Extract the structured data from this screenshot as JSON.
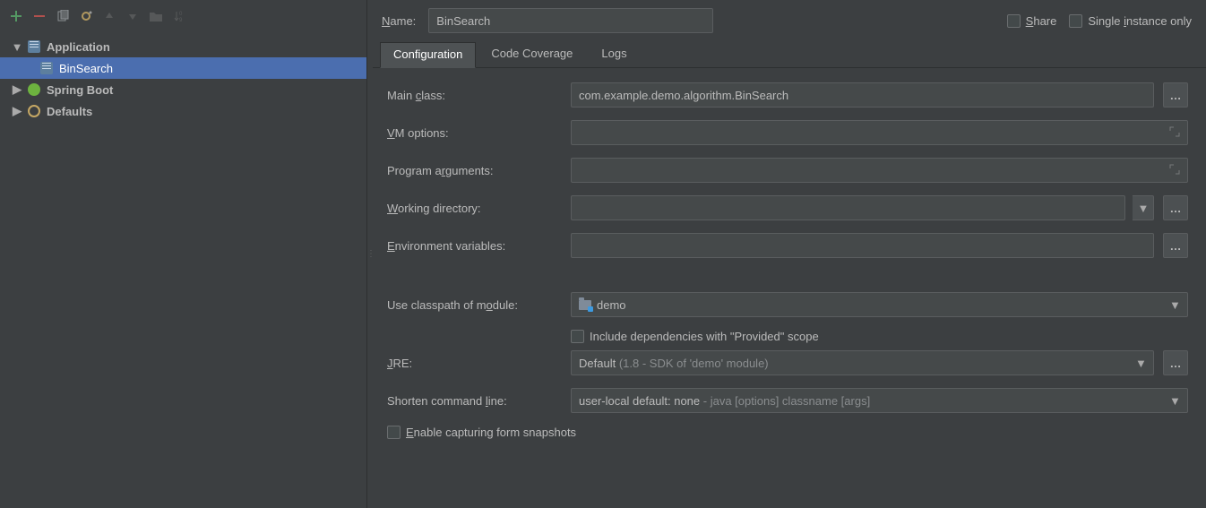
{
  "header": {
    "name_label": "Name:",
    "name_value": "BinSearch",
    "share_label": "Share",
    "single_instance_label": "Single instance only"
  },
  "sidebar": {
    "items": [
      {
        "label": "Application",
        "expanded": true,
        "children": [
          {
            "label": "BinSearch",
            "selected": true
          }
        ]
      },
      {
        "label": "Spring Boot",
        "expanded": false
      },
      {
        "label": "Defaults",
        "expanded": false
      }
    ]
  },
  "tabs": {
    "items": [
      "Configuration",
      "Code Coverage",
      "Logs"
    ],
    "active": 0
  },
  "form": {
    "main_class_label": "Main class:",
    "main_class_value": "com.example.demo.algorithm.BinSearch",
    "vm_options_label": "VM options:",
    "vm_options_value": "",
    "program_args_label": "Program arguments:",
    "program_args_value": "",
    "working_dir_label": "Working directory:",
    "working_dir_value": "",
    "env_vars_label": "Environment variables:",
    "env_vars_value": "",
    "classpath_label": "Use classpath of module:",
    "classpath_value": "demo",
    "include_provided_label": "Include dependencies with \"Provided\" scope",
    "jre_label": "JRE:",
    "jre_value": "Default",
    "jre_hint": " (1.8 - SDK of 'demo' module)",
    "shorten_label": "Shorten command line:",
    "shorten_value": "user-local default: none",
    "shorten_hint": " - java [options] classname [args]",
    "enable_snapshots_label": "Enable capturing form snapshots"
  }
}
